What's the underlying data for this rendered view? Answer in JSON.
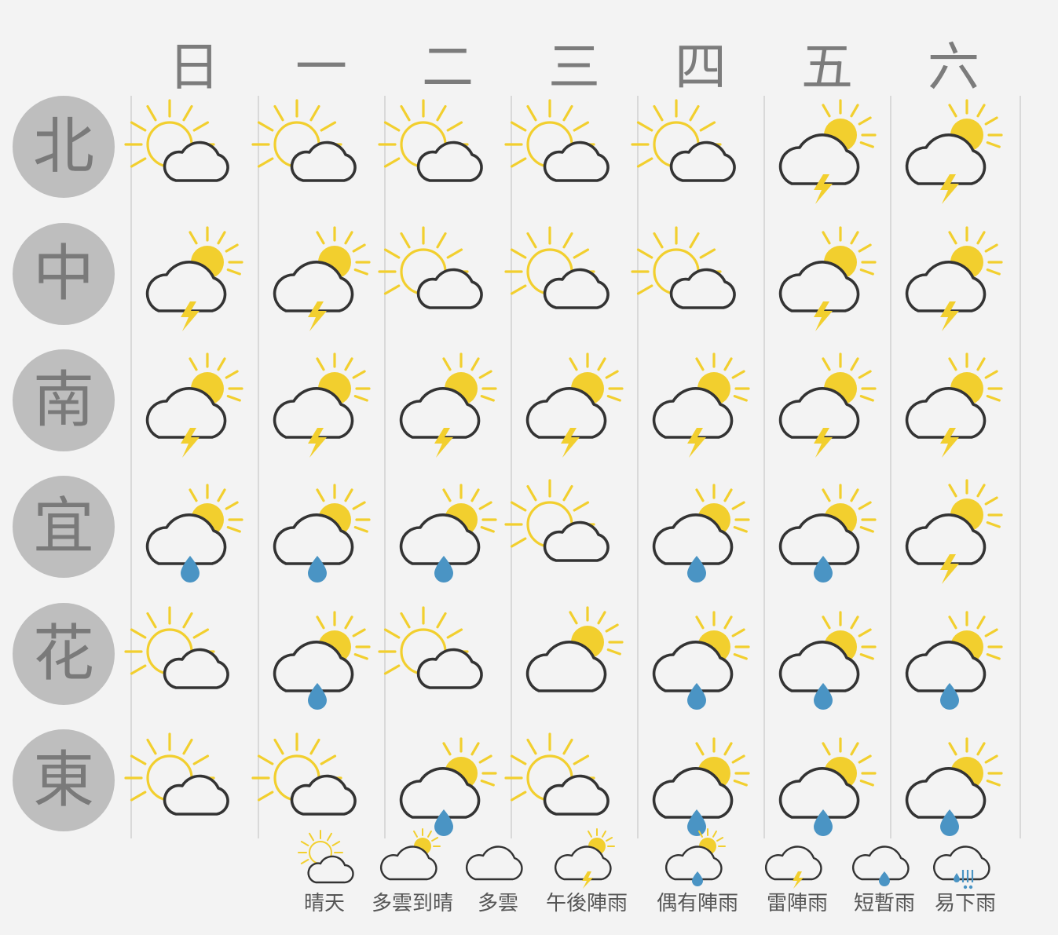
{
  "days": [
    "日",
    "一",
    "二",
    "三",
    "四",
    "五",
    "六"
  ],
  "regions": [
    {
      "name": "北",
      "forecast": [
        "sunny_cloudy",
        "sunny_cloudy",
        "sunny_cloudy",
        "sunny_cloudy",
        "sunny_cloudy",
        "thunderstorm",
        "thunderstorm"
      ]
    },
    {
      "name": "中",
      "forecast": [
        "thunderstorm",
        "thunderstorm",
        "sunny_cloudy",
        "sunny_cloudy",
        "sunny_cloudy",
        "thunderstorm",
        "thunderstorm"
      ]
    },
    {
      "name": "南",
      "forecast": [
        "thunderstorm",
        "thunderstorm",
        "thunderstorm",
        "thunderstorm",
        "thunderstorm",
        "thunderstorm",
        "thunderstorm"
      ]
    },
    {
      "name": "宜",
      "forecast": [
        "shower",
        "shower",
        "shower",
        "sunny_cloudy",
        "shower",
        "shower",
        "thunderstorm"
      ]
    },
    {
      "name": "花",
      "forecast": [
        "sunny_cloudy",
        "shower",
        "sunny_cloudy",
        "cloudy_clearing",
        "shower",
        "shower",
        "shower"
      ]
    },
    {
      "name": "東",
      "forecast": [
        "sunny_cloudy",
        "sunny_cloudy",
        "shower",
        "sunny_cloudy",
        "shower",
        "shower",
        "shower"
      ]
    }
  ],
  "legend": [
    {
      "icon": "sunny_cloudy",
      "label": "晴天"
    },
    {
      "icon": "cloudy_clearing",
      "label": "多雲到晴"
    },
    {
      "icon": "cloudy",
      "label": "多雲"
    },
    {
      "icon": "thunderstorm",
      "label": "午後陣雨"
    },
    {
      "icon": "shower",
      "label": "偶有陣雨"
    },
    {
      "icon": "thunder_cloud",
      "label": "雷陣雨"
    },
    {
      "icon": "rain_cloud",
      "label": "短暫雨"
    },
    {
      "icon": "heavy_rain_cloud",
      "label": "易下雨"
    }
  ],
  "colors": {
    "sun": "#f2cf2e",
    "cloud_stroke": "#333333",
    "raindrop": "#4a94c4",
    "badge": "#bebebe",
    "text": "#7a7a7a"
  }
}
